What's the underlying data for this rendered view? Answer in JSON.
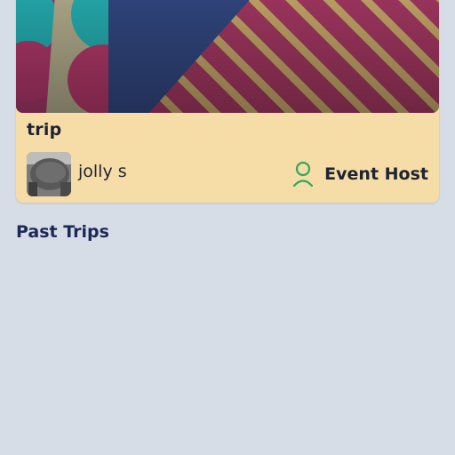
{
  "trip_card": {
    "title": "trip",
    "host_name": "jolly s",
    "host_role_label": "Event Host",
    "host_role_icon": "person-outline-icon",
    "accent_colors": {
      "card_background": "#f6dca6",
      "role_icon": "#2eaa5a"
    }
  },
  "past_trips": {
    "section_title": "Past Trips"
  }
}
